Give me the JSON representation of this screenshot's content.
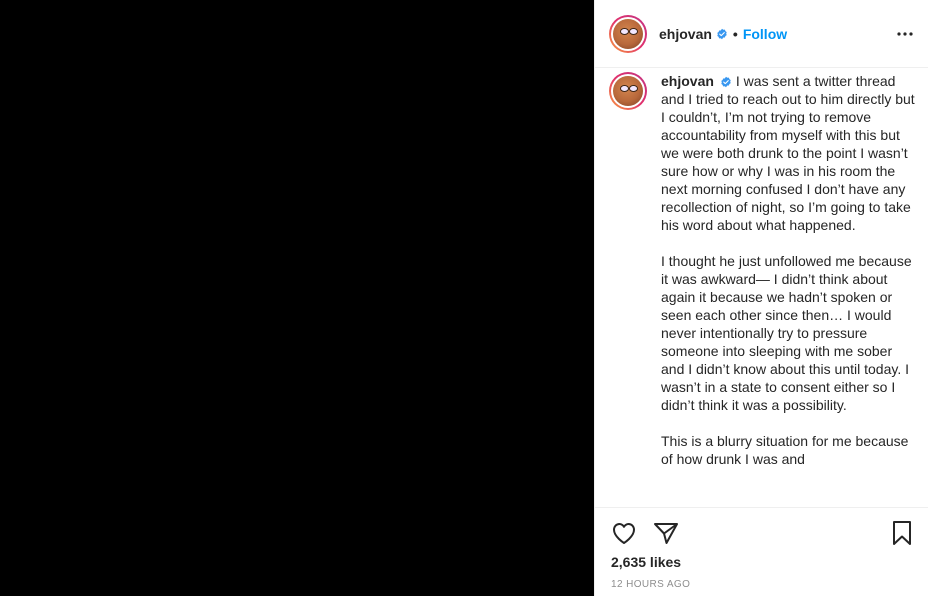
{
  "post": {
    "username": "ehjovan",
    "follow_label": "Follow",
    "separator": "•",
    "caption_username": "ehjovan",
    "caption": "I was sent a twitter thread and I tried to reach out to him directly but I couldn’t, I’m not trying to remove accountability from myself with this but we were both drunk to the point I wasn’t sure how or why I was in his room the next morning confused I don’t have any recollection of night, so I’m going to take his word about what happened.\n\nI thought he just unfollowed me because it was awkward— I didn’t think about again it because we hadn’t spoken or seen each other since then… I would never intentionally try to pressure someone into sleeping with me sober and I didn’t know about this until today. I wasn’t in a state to consent either so I didn’t think it was a possibility.\n\nThis is a blurry situation for me because of how drunk I was and",
    "likes": "2,635 likes",
    "timestamp": "12 HOURS AGO"
  },
  "icons": {
    "verified": "verified-badge-icon",
    "more": "more-options-icon",
    "like": "heart-icon",
    "share": "send-icon",
    "save": "bookmark-icon"
  },
  "colors": {
    "link": "#0095f6",
    "verified": "#3897f0",
    "text": "#262626",
    "muted": "#8e8e8e",
    "media_bg": "#000000"
  }
}
